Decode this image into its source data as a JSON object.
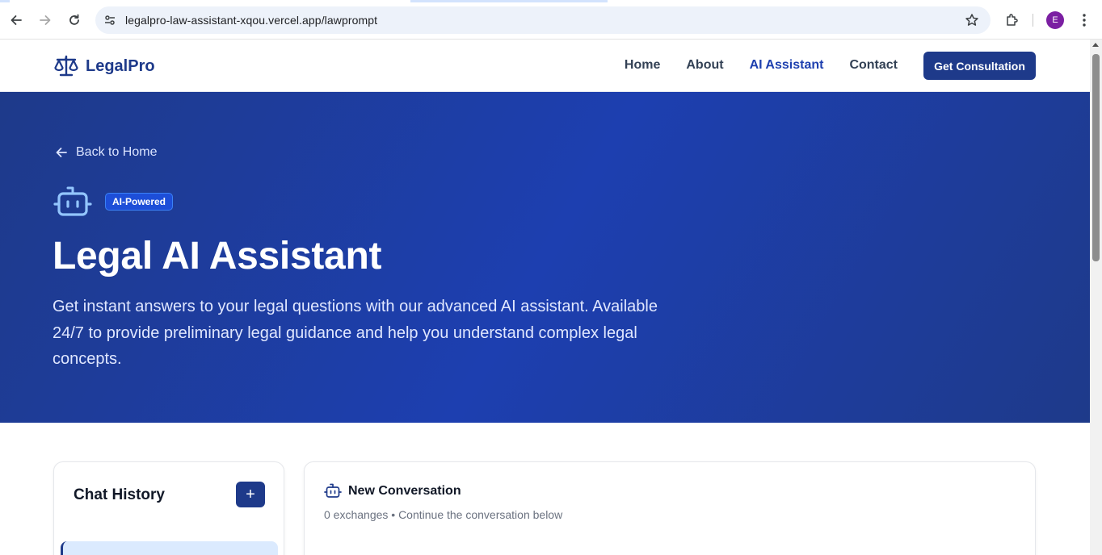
{
  "browser": {
    "url": "legalpro-law-assistant-xqou.vercel.app/lawprompt",
    "profile_initial": "E",
    "icons": [
      "back-arrow-icon",
      "forward-arrow-icon",
      "reload-icon",
      "site-settings-icon",
      "bookmark-star-icon",
      "extensions-icon",
      "more-menu-icon"
    ]
  },
  "site": {
    "brand": "LegalPro",
    "nav": {
      "home": "Home",
      "about": "About",
      "ai_assistant": "AI Assistant",
      "contact": "Contact"
    },
    "cta": "Get Consultation"
  },
  "hero": {
    "back_label": "Back to Home",
    "badge": "AI-Powered",
    "title": "Legal AI Assistant",
    "description": "Get instant answers to your legal questions with our advanced AI assistant. Available 24/7 to provide preliminary legal guidance and help you understand complex legal concepts."
  },
  "chat_history": {
    "title": "Chat History",
    "add_label": "+"
  },
  "conversation": {
    "title": "New Conversation",
    "subtitle": "0 exchanges • Continue the conversation below"
  },
  "colors": {
    "brand_navy": "#1e3a8a",
    "hero_blue": "#1d3fb0",
    "active_link": "#1e40af",
    "profile_purple": "#7b1fa2"
  }
}
